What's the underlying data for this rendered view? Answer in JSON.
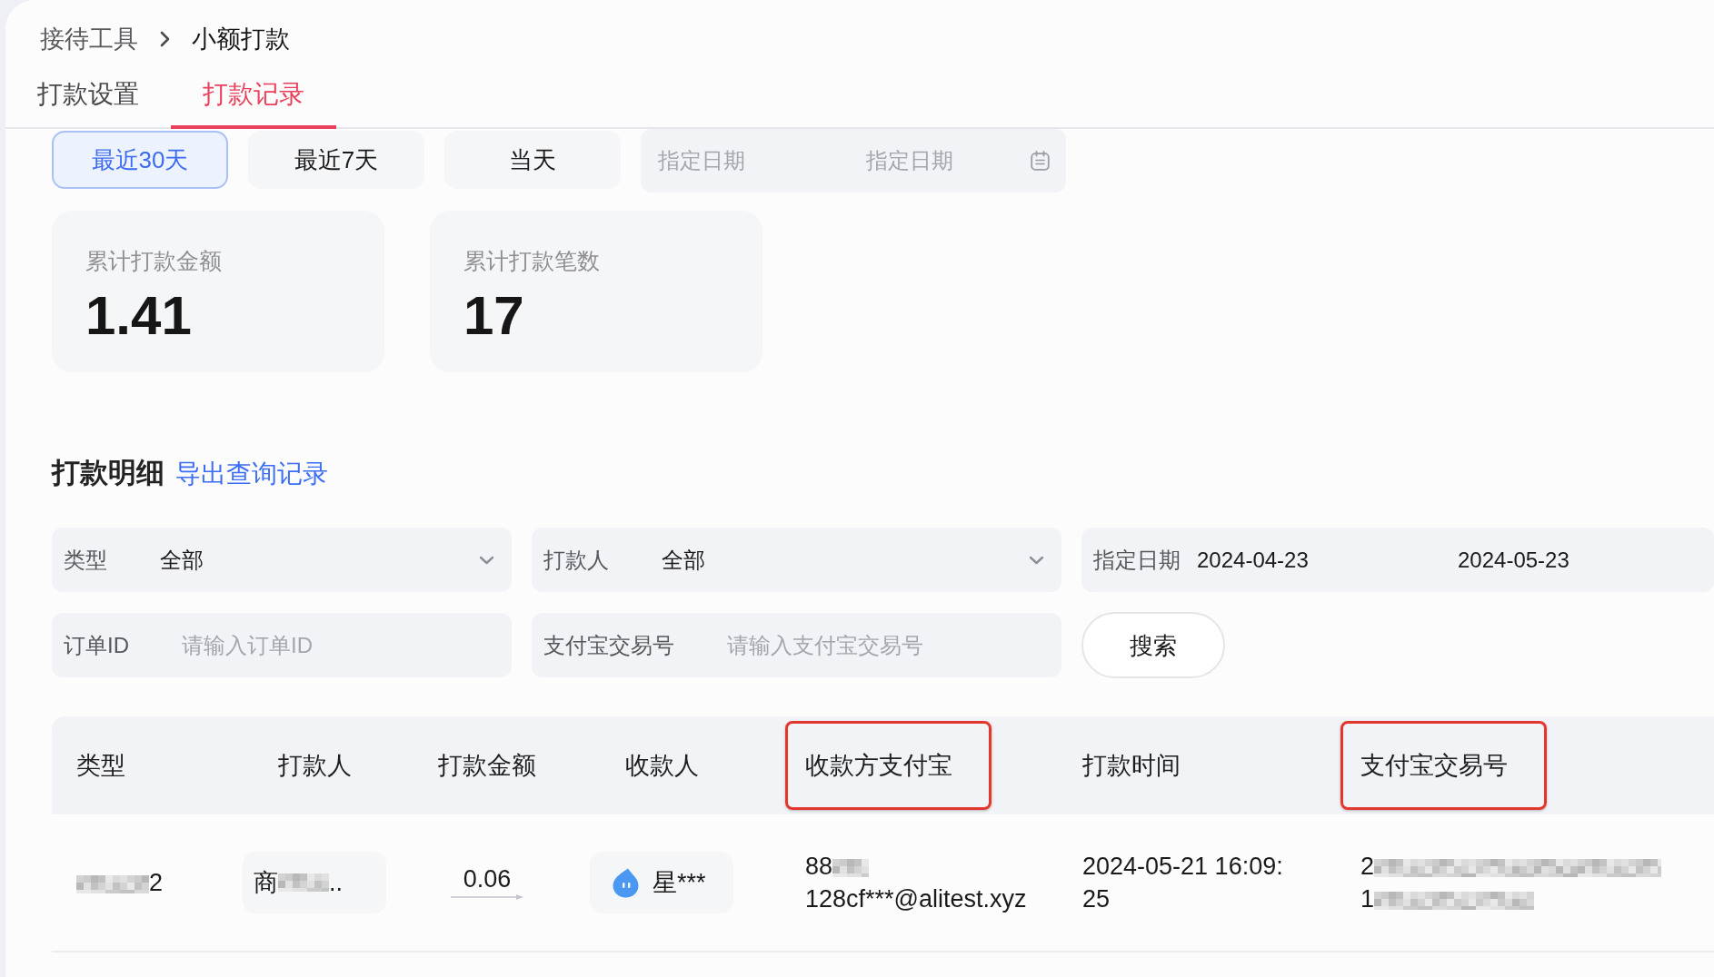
{
  "breadcrumb": [
    {
      "label": "接待工具",
      "current": false
    },
    {
      "label": "小额打款",
      "current": true
    }
  ],
  "tabs": [
    {
      "label": "打款设置",
      "selected": false
    },
    {
      "label": "打款记录",
      "selected": true
    }
  ],
  "date_presets": [
    {
      "label": "最近30天",
      "selected": true
    },
    {
      "label": "最近7天",
      "selected": false
    },
    {
      "label": "当天",
      "selected": false
    }
  ],
  "date_range": {
    "start_placeholder": "指定日期",
    "end_placeholder": "指定日期"
  },
  "stats": [
    {
      "label": "累计打款金额",
      "value": "1.41"
    },
    {
      "label": "累计打款笔数",
      "value": "17"
    }
  ],
  "details": {
    "title": "打款明细",
    "export_link": "导出查询记录"
  },
  "filters": [
    {
      "kind": "select",
      "label": "类型",
      "value": "全部"
    },
    {
      "kind": "select",
      "label": "打款人",
      "value": "全部"
    },
    {
      "kind": "date_range",
      "label": "指定日期",
      "start": "2024-04-23",
      "end": "2024-05-23"
    },
    {
      "kind": "input",
      "label": "订单ID",
      "placeholder": "请输入订单ID"
    },
    {
      "kind": "input",
      "label": "支付宝交易号",
      "placeholder": "请输入支付宝交易号"
    },
    {
      "kind": "button",
      "label": "搜索"
    }
  ],
  "table": {
    "columns": [
      {
        "label": "类型",
        "highlighted": false
      },
      {
        "label": "打款人",
        "highlighted": false
      },
      {
        "label": "打款金额",
        "highlighted": false
      },
      {
        "label": "收款人",
        "highlighted": false
      },
      {
        "label": "收款方支付宝",
        "highlighted": true
      },
      {
        "label": "打款时间",
        "highlighted": false
      },
      {
        "label": "支付宝交易号",
        "highlighted": true
      }
    ],
    "rows": [
      {
        "cells": [
          {
            "kind": "masked",
            "parts": [
              {
                "kind": "mosaic"
              },
              {
                "kind": "text",
                "text": "2"
              }
            ]
          },
          {
            "kind": "chip",
            "parts": [
              {
                "kind": "text",
                "text": "商"
              },
              {
                "kind": "mosaic"
              },
              {
                "kind": "text",
                "text": ".."
              }
            ]
          },
          {
            "kind": "amount",
            "text": "0.06"
          },
          {
            "kind": "payee",
            "text": "星***"
          },
          {
            "kind": "masked",
            "parts": [
              {
                "kind": "text",
                "text": "88"
              },
              {
                "kind": "mosaic"
              },
              {
                "kind": "text",
                "text": "128cf***@alit"
              },
              {
                "kind": "text",
                "text": "est.xyz"
              }
            ]
          },
          {
            "kind": "text",
            "text": "2024-05-21 16:09:25"
          },
          {
            "kind": "masked",
            "parts": [
              {
                "kind": "text",
                "text": "2"
              },
              {
                "kind": "mosaic"
              },
              {
                "kind": "text",
                "text": "1"
              },
              {
                "kind": "mosaic"
              }
            ]
          }
        ]
      }
    ]
  }
}
